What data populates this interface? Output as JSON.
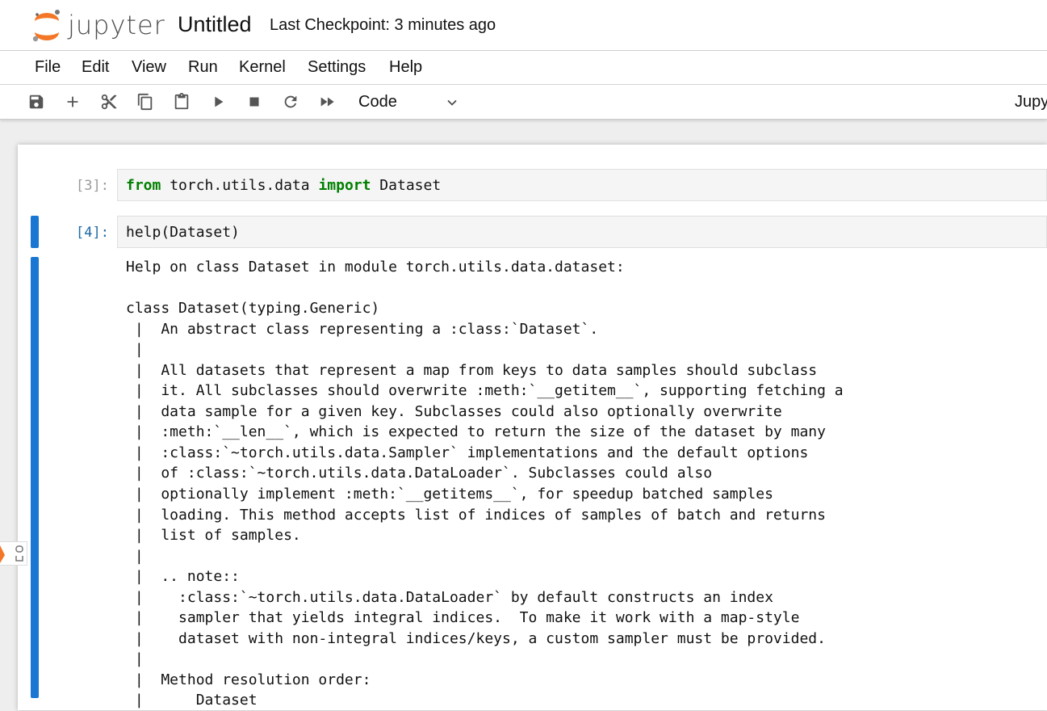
{
  "header": {
    "logo_text": "jupyter",
    "notebook_title": "Untitled",
    "checkpoint": "Last Checkpoint: 3 minutes ago"
  },
  "menu": [
    "File",
    "Edit",
    "View",
    "Run",
    "Kernel",
    "Settings",
    "Help"
  ],
  "toolbar": {
    "buttons": [
      "save-icon",
      "add-cell-icon",
      "cut-icon",
      "copy-icon",
      "paste-icon",
      "run-icon",
      "stop-icon",
      "restart-icon",
      "fast-forward-icon"
    ],
    "cell_type": "Code",
    "kernel_label": "Jupy"
  },
  "cells": [
    {
      "prompt": "[3]:",
      "code_parts": [
        "from",
        " torch.utils.data ",
        "import",
        " Dataset"
      ]
    },
    {
      "prompt": "[4]:",
      "code": "help(Dataset)",
      "output": "Help on class Dataset in module torch.utils.data.dataset:\n\nclass Dataset(typing.Generic)\n |  An abstract class representing a :class:`Dataset`.\n |\n |  All datasets that represent a map from keys to data samples should subclass\n |  it. All subclasses should overwrite :meth:`__getitem__`, supporting fetching a\n |  data sample for a given key. Subclasses could also optionally overwrite\n |  :meth:`__len__`, which is expected to return the size of the dataset by many\n |  :class:`~torch.utils.data.Sampler` implementations and the default options\n |  of :class:`~torch.utils.data.DataLoader`. Subclasses could also\n |  optionally implement :meth:`__getitems__`, for speedup batched samples\n |  loading. This method accepts list of indices of samples of batch and returns\n |  list of samples.\n |\n |  .. note::\n |    :class:`~torch.utils.data.DataLoader` by default constructs an index\n |    sampler that yields integral indices.  To make it work with a map-style\n |    dataset with non-integral indices/keys, a custom sampler must be provided.\n |\n |  Method resolution order:\n |      Dataset"
    }
  ],
  "colors": {
    "accent": "#1976d2",
    "prompt_active": "#1f6aa5",
    "keyword": "#008000",
    "logo_orange": "#f37726"
  }
}
